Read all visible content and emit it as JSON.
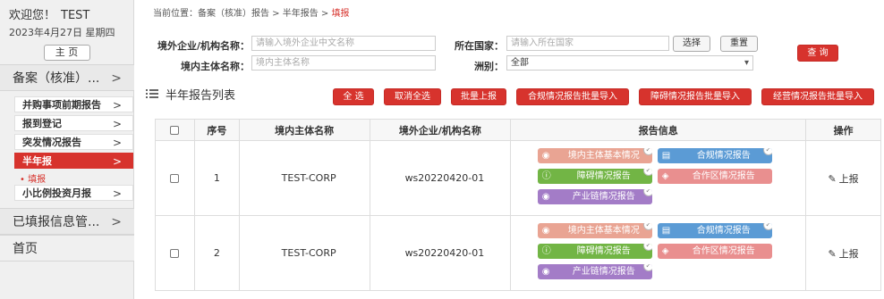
{
  "sidebar": {
    "welcome": "欢迎您！",
    "user": "TEST",
    "date": "2023年4月27日 星期四",
    "home_button": "主 页",
    "section_filing": "备案（核准）...",
    "items": [
      {
        "label": "并购事项前期报告"
      },
      {
        "label": "报到登记"
      },
      {
        "label": "突发情况报告"
      },
      {
        "label": "半年报"
      },
      {
        "label": "小比例投资月报"
      }
    ],
    "leaf": "• 填报",
    "section_submitted": "已填报信息管...",
    "section_home": "首页",
    "chevron": ">"
  },
  "breadcrumb": {
    "prefix": "当前位置：",
    "path": "备案（核准）报告 > 半年报告 > ",
    "current": "填报"
  },
  "filters": {
    "foreign_label": "境外企业/机构名称：",
    "foreign_placeholder": "请输入境外企业中文名称",
    "country_label": "所在国家：",
    "country_placeholder": "请输入所在国家",
    "select_button": "选择",
    "reset_button": "重置",
    "query_button": "查 询",
    "domestic_label": "境内主体名称：",
    "domestic_placeholder": "境内主体名称",
    "continent_label": "洲别：",
    "continent_value": "全部"
  },
  "list": {
    "title": "半年报告列表",
    "buttons": {
      "select_all": "全 选",
      "cancel_all": "取消全选",
      "batch_report": "批量上报",
      "import_compliance": "合规情况报告批量导入",
      "import_obstacle": "障碍情况报告批量导入",
      "import_operation": "经营情况报告批量导入"
    }
  },
  "table": {
    "headers": {
      "seq": "序号",
      "domestic": "境内主体名称",
      "foreign": "境外企业/机构名称",
      "reports": "报告信息",
      "action": "操作"
    },
    "rows": [
      {
        "seq": "1",
        "domestic": "TEST-CORP",
        "foreign": "ws20220420-01"
      },
      {
        "seq": "2",
        "domestic": "TEST-CORP",
        "foreign": "ws20220420-01"
      }
    ],
    "report_tags": {
      "basic": "境内主体基本情况",
      "compliance": "合规情况报告",
      "obstacle": "障碍情况报告",
      "cooperation": "合作区情况报告",
      "chain": "产业链情况报告"
    },
    "action_label": "上报",
    "check_mark": "✓"
  },
  "colors": {
    "accent_red": "#d7332d",
    "tag_salmon": "#e9a493",
    "tag_blue": "#5b9bd5",
    "tag_green": "#72b545",
    "tag_pink": "#e98f8f",
    "tag_purple": "#a37cc7"
  }
}
